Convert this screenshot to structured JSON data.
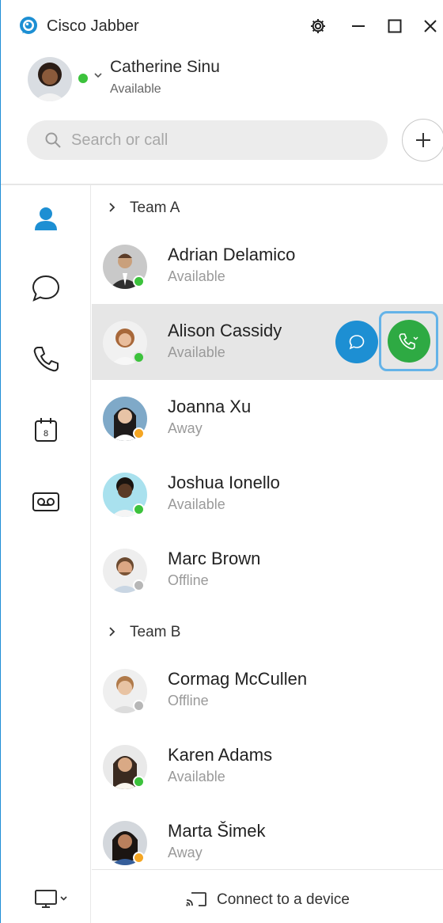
{
  "app": {
    "title": "Cisco Jabber"
  },
  "colors": {
    "available": "#3cc23c",
    "away": "#f5a623",
    "offline": "#b7b7b7",
    "accent": "#1d8fd3",
    "call": "#2eaa43"
  },
  "profile": {
    "name": "Catherine Sinu",
    "presence": "Available",
    "status": "available"
  },
  "search": {
    "placeholder": "Search or call",
    "value": ""
  },
  "nav": {
    "items": [
      {
        "id": "contacts",
        "icon": "person-icon",
        "active": true
      },
      {
        "id": "chat",
        "icon": "chat-bubble-icon",
        "active": false
      },
      {
        "id": "calls",
        "icon": "phone-icon",
        "active": false
      },
      {
        "id": "meetings",
        "icon": "calendar-icon",
        "day": "8",
        "active": false
      },
      {
        "id": "voicemail",
        "icon": "voicemail-icon",
        "active": false
      }
    ],
    "device_icon": "monitor-icon"
  },
  "groups": [
    {
      "label": "Team A",
      "contacts": [
        {
          "name": "Adrian Delamico",
          "presence": "Available",
          "status": "available"
        },
        {
          "name": "Alison Cassidy",
          "presence": "Available",
          "status": "available",
          "selected": true
        },
        {
          "name": "Joanna Xu",
          "presence": "Away",
          "status": "away"
        },
        {
          "name": "Joshua Ionello",
          "presence": "Available",
          "status": "available"
        },
        {
          "name": "Marc Brown",
          "presence": "Offline",
          "status": "offline"
        }
      ]
    },
    {
      "label": "Team B",
      "contacts": [
        {
          "name": "Cormag McCullen",
          "presence": "Offline",
          "status": "offline"
        },
        {
          "name": "Karen Adams",
          "presence": "Available",
          "status": "available"
        },
        {
          "name": "Marta Šimek",
          "presence": "Away",
          "status": "away"
        }
      ]
    }
  ],
  "bottom": {
    "connect_label": "Connect to a device"
  }
}
